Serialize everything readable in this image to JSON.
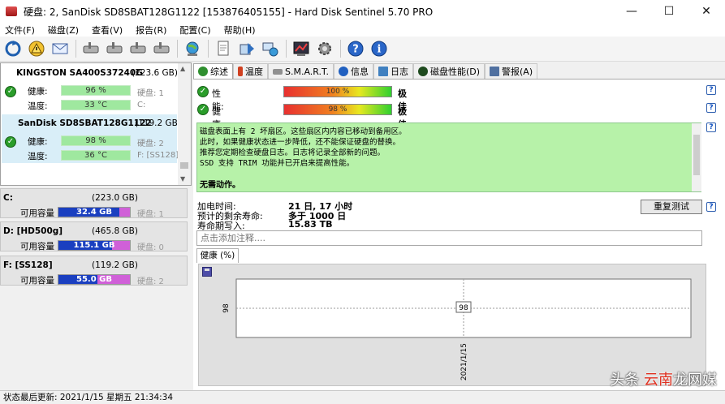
{
  "window": {
    "title": "硬盘:  2, SanDisk SD8SBAT128G1122 [153876405155]  -  Hard Disk Sentinel 5.70 PRO",
    "minimize": "—",
    "maximize": "☐",
    "close": "✕"
  },
  "menu": [
    "文件(F)",
    "磁盘(Z)",
    "查看(V)",
    "报告(R)",
    "配置(C)",
    "帮助(H)"
  ],
  "toolbar_icons": [
    "refresh-icon",
    "alert-icon",
    "mail-icon",
    "disk-tool-icon",
    "disk-tool-icon",
    "disk-tool-icon",
    "disk-tool-icon",
    "network-icon",
    "report-icon",
    "disk-send-icon",
    "disk-network-icon",
    "chart-icon",
    "settings-icon",
    "help-icon",
    "info-icon"
  ],
  "disks": [
    {
      "name": "KINGSTON SA400S37240G",
      "size": "(223.6 GB)",
      "health_label": "健康:",
      "health": "96 %",
      "health_extra": "硬盘: 1",
      "temp_label": "温度:",
      "temp": "33 °C",
      "temp_extra": "C:",
      "selected": false
    },
    {
      "name": "SanDisk SD8SBAT128G1122",
      "size": "(119.2 GB)",
      "health_label": "健康:",
      "health": "98 %",
      "health_extra": "硬盘: 2",
      "temp_label": "温度:",
      "temp": "36 °C",
      "temp_extra": "F: [SS128]",
      "selected": true
    }
  ],
  "volumes": [
    {
      "name": "C:",
      "size": "(223.0 GB)",
      "free_label": "可用容量",
      "free": "32.4 GB",
      "used_fraction": 0.85,
      "disk": "硬盘: 1"
    },
    {
      "name": "D: [HD500g]",
      "size": "(465.8 GB)",
      "free_label": "可用容量",
      "free": "115.1 GB",
      "used_fraction": 0.75,
      "disk": "硬盘: 0"
    },
    {
      "name": "F: [SS128]",
      "size": "(119.2 GB)",
      "free_label": "可用容量",
      "free": "55.0 GB",
      "used_fraction": 0.54,
      "disk": "硬盘: 2"
    }
  ],
  "tabs": [
    {
      "label": "综述",
      "icon": "overview-icon",
      "color": "#2f8f2f",
      "active": true
    },
    {
      "label": "温度",
      "icon": "temperature-icon",
      "color": "#d04020",
      "active": false
    },
    {
      "label": "S.M.A.R.T.",
      "icon": "smart-icon",
      "color": "#707070",
      "active": false
    },
    {
      "label": "信息",
      "icon": "info-icon",
      "color": "#2060c0",
      "active": false
    },
    {
      "label": "日志",
      "icon": "log-icon",
      "color": "#4080c0",
      "active": false
    },
    {
      "label": "磁盘性能(D)",
      "icon": "performance-icon",
      "color": "#306030",
      "active": false
    },
    {
      "label": "警报(A)",
      "icon": "alert-icon",
      "color": "#5070a0",
      "active": false
    }
  ],
  "stats": [
    {
      "label": "性能:",
      "value": "100 %",
      "fraction": 1.0,
      "rating": "极佳"
    },
    {
      "label": "健康:",
      "value": "98 %",
      "fraction": 0.98,
      "rating": "极佳"
    }
  ],
  "message": {
    "lines": [
      "磁盘表面上有 2 坏扇区。这些扇区内内容已移动到备用区。",
      "此时，如果健康状态进一步降低，还不能保证硬盘的替换。",
      "推荐您定期检查硬盘日志。日志将记录全部新的问题。",
      "SSD 支持 TRIM 功能并已开启来提高性能。"
    ],
    "action": "无需动作。"
  },
  "info": [
    {
      "label": "加电时间:",
      "value": "21 日, 17 小时"
    },
    {
      "label": "预计的剩余寿命:",
      "value": "多于 1000 日"
    },
    {
      "label": "寿命期写入:",
      "value": "15.83 TB"
    }
  ],
  "retest_button": "重复测试",
  "note_placeholder": "点击添加注释....",
  "chart_tab": "健康 (%)",
  "chart_data": {
    "type": "line",
    "title": "",
    "xlabel": "",
    "ylabel": "",
    "x": [
      "2021/1/15"
    ],
    "series": [
      {
        "values": [
          98
        ]
      }
    ],
    "ylim": [
      97,
      99
    ],
    "grid": true
  },
  "status": "状态最后更新:    2021/1/15 星期五 21:34:34",
  "watermark": {
    "part1": "头条 ",
    "part2": "云南",
    "part3": "龙网媒"
  }
}
